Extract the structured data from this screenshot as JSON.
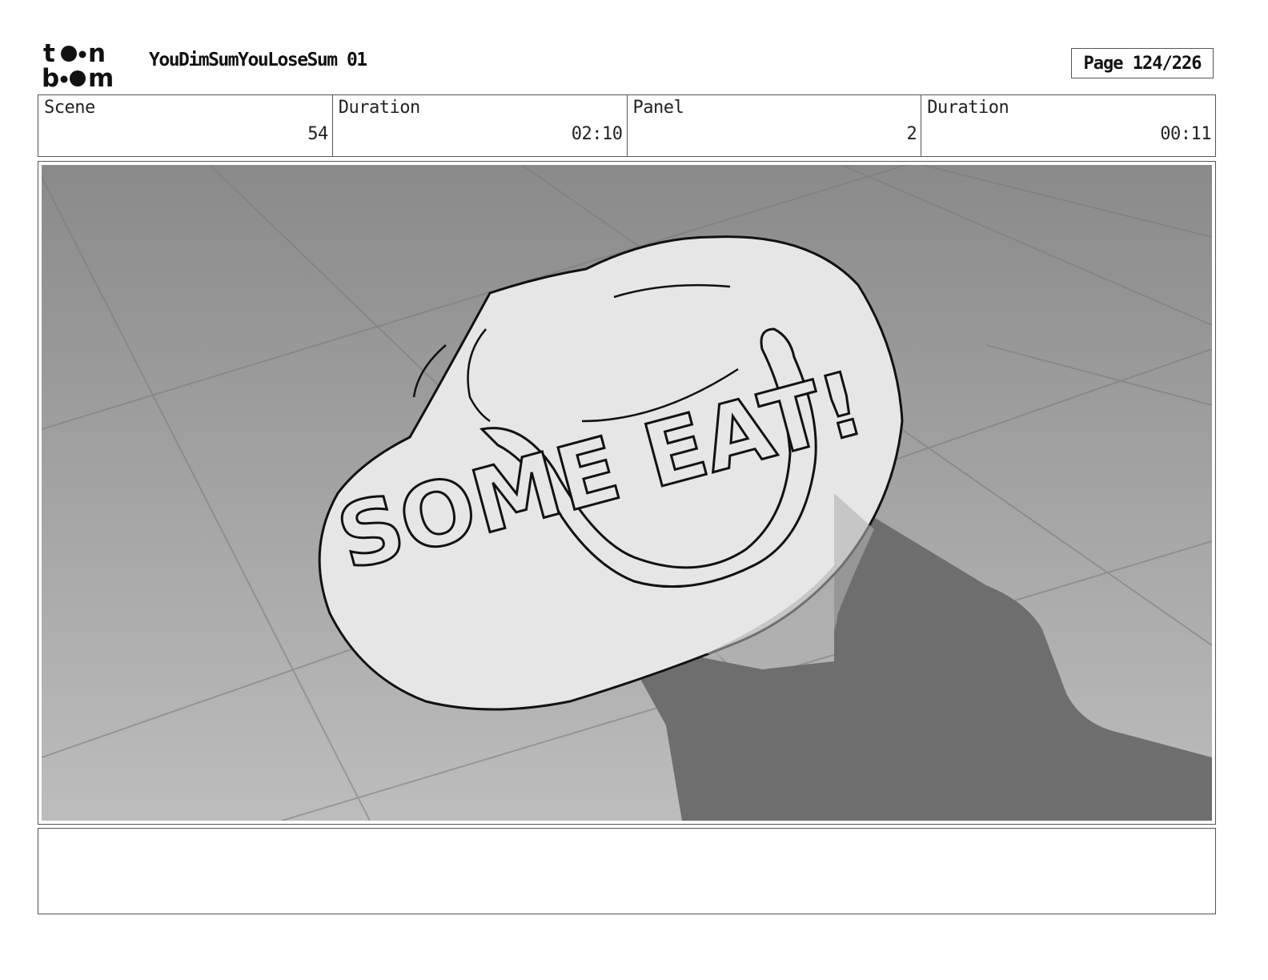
{
  "header": {
    "logo_text": "toon boom",
    "project_title": "YouDimSumYouLoseSum 01",
    "page_label": "Page 124/226"
  },
  "info": {
    "scene_label": "Scene",
    "scene_value": "54",
    "scene_duration_label": "Duration",
    "scene_duration_value": "02:10",
    "panel_label": "Panel",
    "panel_value": "2",
    "panel_duration_label": "Duration",
    "panel_duration_value": "00:11"
  },
  "panel": {
    "artwork_description_icon": "dumpling-drawing",
    "lettering_text": "SOME EAT!"
  },
  "notes": {
    "text": ""
  }
}
